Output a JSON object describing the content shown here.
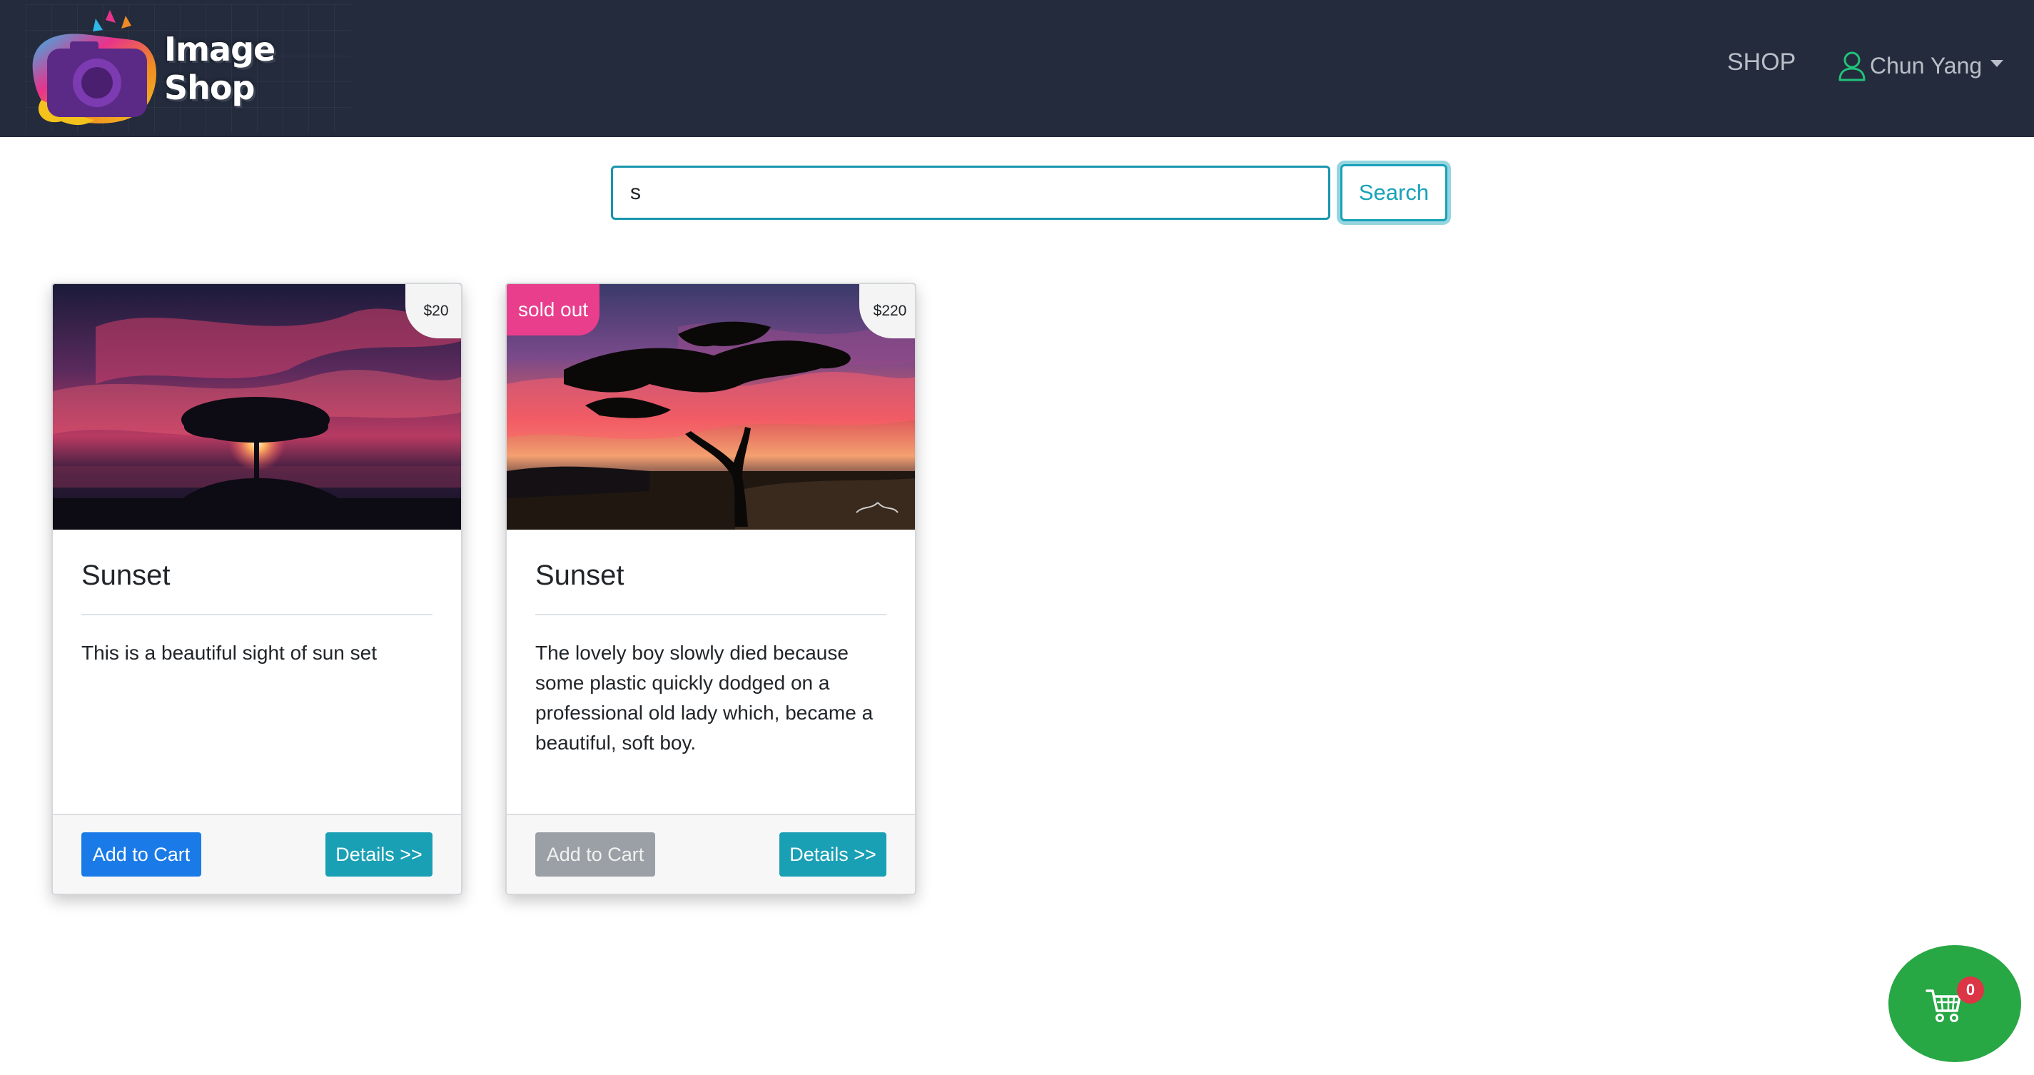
{
  "header": {
    "brand_name": "Image Shop",
    "nav_shop": "SHOP",
    "user_name": "Chun Yang",
    "icons": {
      "logo": "camera-logo-icon",
      "user": "user-icon",
      "dropdown": "caret-down-icon"
    }
  },
  "search": {
    "value": "s",
    "button_label": "Search"
  },
  "products": [
    {
      "title": "Sunset",
      "price": "$20",
      "sold_out": false,
      "description": "This is a beautiful sight of sun set",
      "add_to_cart_label": "Add to Cart",
      "details_label": "Details >>"
    },
    {
      "title": "Sunset",
      "price": "$220",
      "sold_out": true,
      "sold_out_label": "sold out",
      "description": "The lovely boy slowly died because some plastic quickly dodged on a professional old lady which, became a beautiful, soft boy.",
      "add_to_cart_label": "Add to Cart",
      "details_label": "Details >>"
    }
  ],
  "cart": {
    "count": "0",
    "icon": "shopping-cart-icon"
  },
  "colors": {
    "navbar": "#232b3c",
    "primary": "#1a7be8",
    "info": "#17a2b8",
    "sold_out": "#e83e8c",
    "cart_fab": "#28a745",
    "badge": "#dc3545"
  }
}
